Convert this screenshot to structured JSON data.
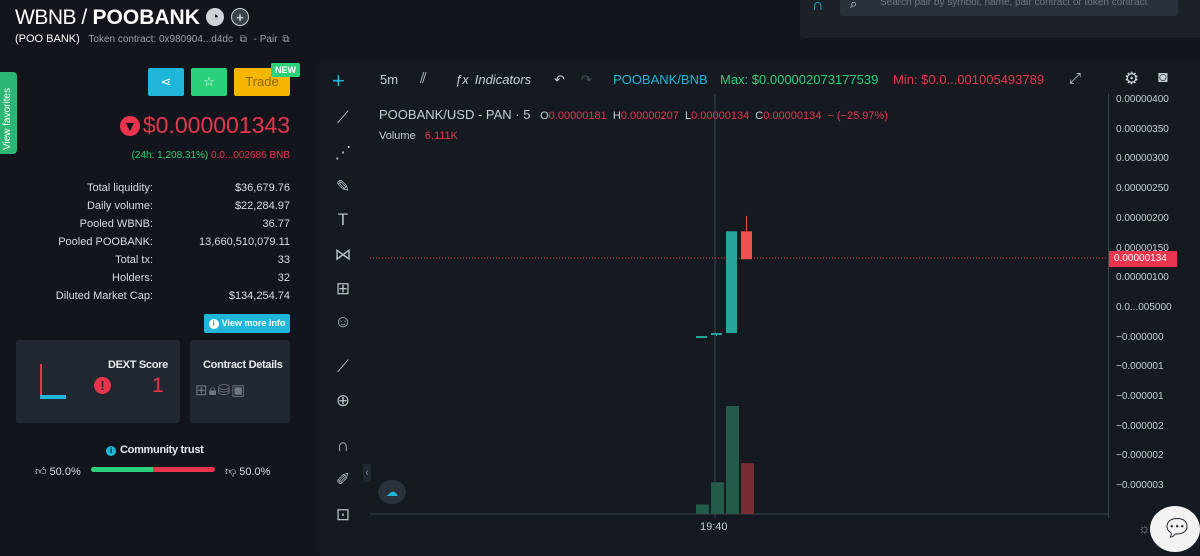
{
  "header": {
    "quote_symbol": "WBNB /",
    "base_symbol": "POOBANK",
    "token_name": "(POO BANK)",
    "token_contract": "Token contract: 0x980904...d4dc",
    "pair_label": "- Pair",
    "search_placeholder": "Search pair by symbol, name, pair contract or token contract"
  },
  "sidebar": {
    "favorites_label": "View favorites",
    "trade_label": "Trade",
    "new_badge": "NEW",
    "price": "$0.000001343",
    "change_pct": "(24h: 1,208.31%)",
    "change_bnb": "0.0...002686 BNB",
    "stats": [
      {
        "label": "Total liquidity:",
        "value": "$36,679.76"
      },
      {
        "label": "Daily volume:",
        "value": "$22,284.97"
      },
      {
        "label": "Pooled WBNB:",
        "value": "36.77"
      },
      {
        "label": "Pooled POOBANK:",
        "value": "13,660,510,079.11"
      },
      {
        "label": "Total tx:",
        "value": "33"
      },
      {
        "label": "Holders:",
        "value": "32"
      },
      {
        "label": "Diluted Market Cap:",
        "value": "$134,254.74"
      }
    ],
    "more_info_label": "View more info",
    "dext_score_title": "DEXT Score",
    "dext_score_value": "1",
    "contract_details_title": "Contract Details",
    "community_trust_title": "Community trust",
    "trust_up": "50.0%",
    "trust_down": "50.0%",
    "trust_up_fraction": 0.5
  },
  "chart": {
    "interval": "5m",
    "indicators_label": "Indicators",
    "pair_symbol": "POOBANK/BNB",
    "max_label": "Max: $0.000002073177539",
    "min_label": "Min: $0.0...001005493789",
    "legend_title": "POOBANK/USD - PAN · 5",
    "legend_o_label": "O",
    "legend_o": "0.00000181",
    "legend_h_label": "H",
    "legend_h": "0.00000207",
    "legend_l_label": "L",
    "legend_l": "0.00000134",
    "legend_c_label": "C",
    "legend_c": "0.00000134",
    "legend_change": "− (−25.97%)",
    "volume_label": "Volume",
    "volume_value": "6.111K",
    "current_price_tag": "0.00000134",
    "y_axis_labels": [
      "0.00000400",
      "0.00000350",
      "0.00000300",
      "0.00000250",
      "0.00000200",
      "0.00000150",
      "0.00000100",
      "0.0...005000",
      "−0.000000",
      "−0.000001",
      "−0.000001",
      "−0.000002",
      "−0.000002",
      "−0.000003"
    ],
    "time_label": "19:40",
    "colors": {
      "up": "#26a69a",
      "down": "#ef5350"
    }
  },
  "chart_data": {
    "type": "candlestick",
    "candles": [
      {
        "open": 5e-08,
        "high": 5e-08,
        "low": 5e-08,
        "close": 5e-08
      },
      {
        "open": 1e-07,
        "high": 1e-07,
        "low": 5e-08,
        "close": 1e-07
      },
      {
        "open": 1e-07,
        "high": 1.81e-06,
        "low": 1e-07,
        "close": 1.81e-06
      },
      {
        "open": 1.81e-06,
        "high": 2.07e-06,
        "low": 1.34e-06,
        "close": 1.34e-06
      }
    ],
    "volume": [
      0.3,
      1.0,
      3.4,
      1.6
    ],
    "x_tick": "19:40"
  }
}
